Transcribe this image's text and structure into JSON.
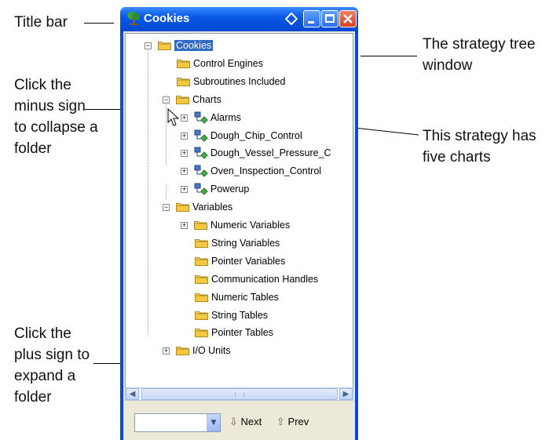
{
  "window": {
    "title": "Cookies",
    "tree": [
      {
        "label": "Cookies",
        "expander": "−",
        "icon": "folder-open-icon",
        "selected": true
      },
      {
        "label": "Control Engines",
        "expander": "",
        "icon": "folder-icon"
      },
      {
        "label": "Subroutines Included",
        "expander": "",
        "icon": "folder-icon"
      },
      {
        "label": "Charts",
        "expander": "−",
        "icon": "folder-icon"
      },
      {
        "label": "Alarms",
        "expander": "+",
        "icon": "chart-icon"
      },
      {
        "label": "Dough_Chip_Control",
        "expander": "+",
        "icon": "chart-icon"
      },
      {
        "label": "Dough_Vessel_Pressure_C",
        "expander": "+",
        "icon": "chart-icon"
      },
      {
        "label": "Oven_Inspection_Control",
        "expander": "+",
        "icon": "chart-icon"
      },
      {
        "label": "Powerup",
        "expander": "+",
        "icon": "chart-icon"
      },
      {
        "label": "Variables",
        "expander": "−",
        "icon": "folder-icon"
      },
      {
        "label": "Numeric Variables",
        "expander": "+",
        "icon": "folder-icon"
      },
      {
        "label": "String Variables",
        "expander": "",
        "icon": "folder-icon"
      },
      {
        "label": "Pointer Variables",
        "expander": "",
        "icon": "folder-icon"
      },
      {
        "label": "Communication Handles",
        "expander": "",
        "icon": "folder-icon"
      },
      {
        "label": "Numeric Tables",
        "expander": "",
        "icon": "folder-icon"
      },
      {
        "label": "String Tables",
        "expander": "",
        "icon": "folder-icon"
      },
      {
        "label": "Pointer Tables",
        "expander": "",
        "icon": "folder-icon"
      },
      {
        "label": "I/O Units",
        "expander": "+",
        "icon": "folder-icon"
      }
    ],
    "next_label": "Next",
    "prev_label": "Prev",
    "combo_value": ""
  },
  "callouts": {
    "title_bar": "Title bar",
    "strategy_tree": "The strategy tree window",
    "minus_sign": "Click the minus sign to collapse a folder",
    "five_charts": "This strategy has five charts",
    "plus_sign": "Click the plus sign to expand a folder"
  },
  "colors": {
    "title_bar": "#0859e6",
    "selection": "#316ac5",
    "folder": "#f5c842"
  }
}
